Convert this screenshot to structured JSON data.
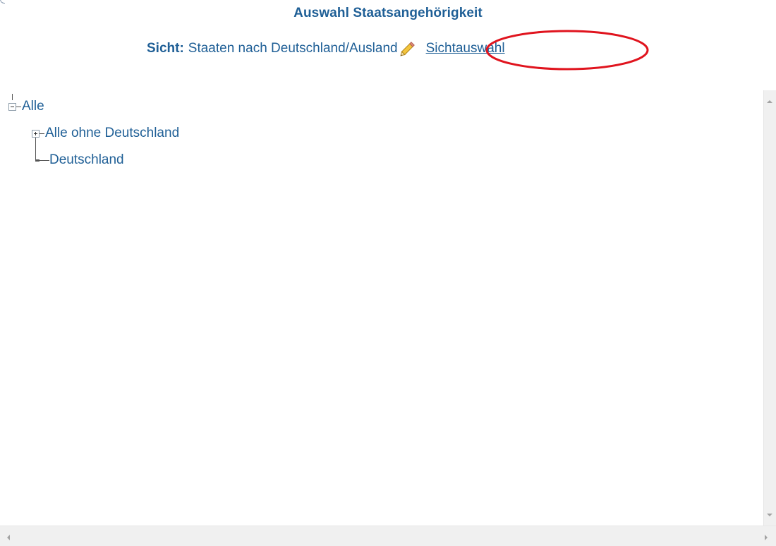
{
  "header": {
    "title": "Auswahl Staatsangehörigkeit",
    "view_prefix": "Sicht:",
    "view_value": "Staaten nach Deutschland/Ausland",
    "view_link_label": "Sichtauswahl"
  },
  "icons": {
    "edit": "pencil-icon",
    "highlight": "red-ellipse-annotation"
  },
  "colors": {
    "text": "#1f5f96",
    "highlight": "#e0141e"
  },
  "tree": {
    "root": {
      "label": "Alle",
      "state": "expanded"
    },
    "children": [
      {
        "label": "Alle ohne Deutschland",
        "state": "collapsed"
      },
      {
        "label": "Deutschland",
        "state": "leaf"
      }
    ]
  }
}
